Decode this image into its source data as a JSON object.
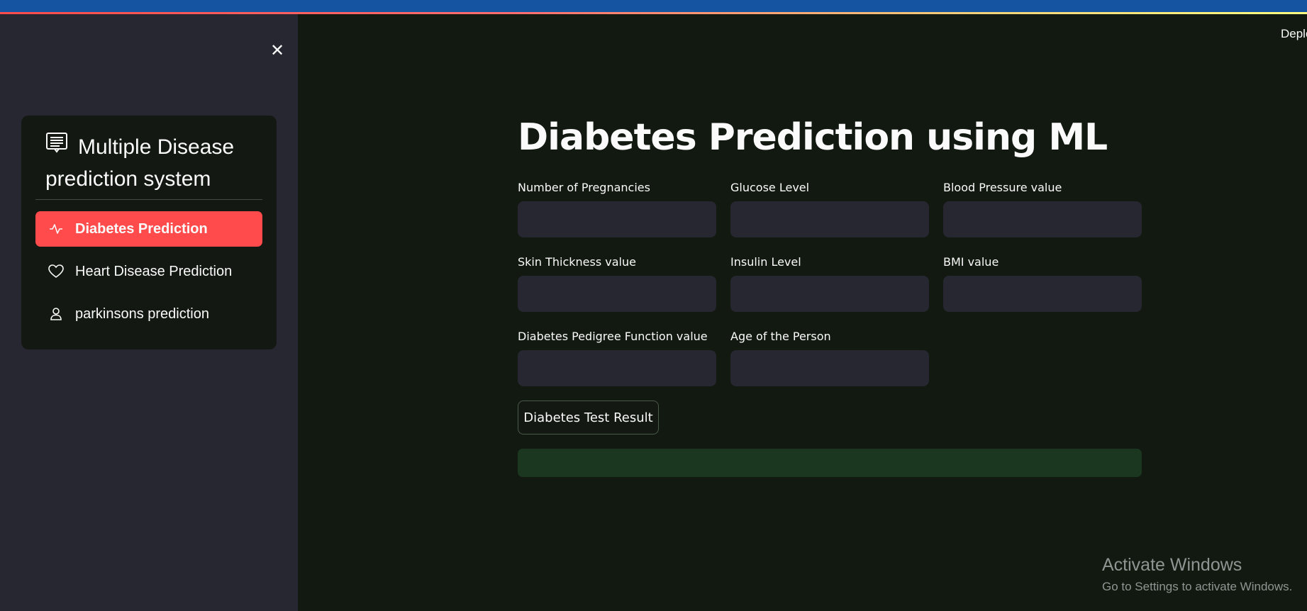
{
  "topbar": {
    "colors": {
      "bar": "#1554a0",
      "gradient_start": "#ff4b4b",
      "gradient_end": "#fffd80"
    }
  },
  "sidebar": {
    "close_icon": "close-icon",
    "menu": {
      "title": "Multiple Disease prediction system",
      "title_icon": "document-list-icon",
      "items": [
        {
          "label": "Diabetes Prediction",
          "icon": "activity-icon",
          "active": true
        },
        {
          "label": "Heart Disease Prediction",
          "icon": "heart-icon",
          "active": false
        },
        {
          "label": "parkinsons prediction",
          "icon": "person-icon",
          "active": false
        }
      ],
      "active_color": "#ff4b4b"
    }
  },
  "header": {
    "deploy_label": "Deplo"
  },
  "main": {
    "title": "Diabetes Prediction using ML",
    "fields": [
      {
        "label": "Number of Pregnancies",
        "value": ""
      },
      {
        "label": "Glucose Level",
        "value": ""
      },
      {
        "label": "Blood Pressure value",
        "value": ""
      },
      {
        "label": "Skin Thickness value",
        "value": ""
      },
      {
        "label": "Insulin Level",
        "value": ""
      },
      {
        "label": "BMI value",
        "value": ""
      },
      {
        "label": "Diabetes Pedigree Function value",
        "value": ""
      },
      {
        "label": "Age of the Person",
        "value": ""
      }
    ],
    "submit_label": "Diabetes Test Result",
    "result_text": "",
    "result_color": "#1c3720"
  },
  "watermark": {
    "title": "Activate Windows",
    "subtitle": "Go to Settings to activate Windows."
  }
}
